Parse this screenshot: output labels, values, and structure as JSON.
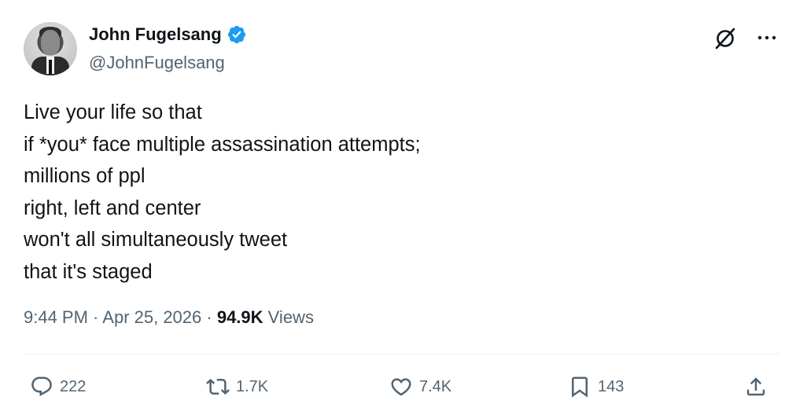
{
  "author": {
    "display_name": "John Fugelsang",
    "handle": "@JohnFugelsang",
    "verified": true,
    "verified_color": "#1d9bf0"
  },
  "header_icons": [
    "grok-icon",
    "more-icon"
  ],
  "tweet": {
    "lines": [
      "Live your life so that",
      "if *you* face multiple assassination attempts;",
      "millions of ppl",
      "right, left and center",
      "won't all simultaneously tweet",
      "that it's staged"
    ]
  },
  "meta": {
    "time": "9:44 PM",
    "separator": " · ",
    "date": "Apr 25, 2026",
    "views_count": "94.9K",
    "views_label": " Views"
  },
  "actions": {
    "reply": {
      "icon": "reply-icon",
      "count": "222"
    },
    "retweet": {
      "icon": "retweet-icon",
      "count": "1.7K"
    },
    "like": {
      "icon": "heart-icon",
      "count": "7.4K"
    },
    "bookmark": {
      "icon": "bookmark-icon",
      "count": "143"
    },
    "share": {
      "icon": "share-icon"
    }
  },
  "colors": {
    "text_primary": "#0f1419",
    "text_secondary": "#536471",
    "divider": "#eff3f4"
  }
}
